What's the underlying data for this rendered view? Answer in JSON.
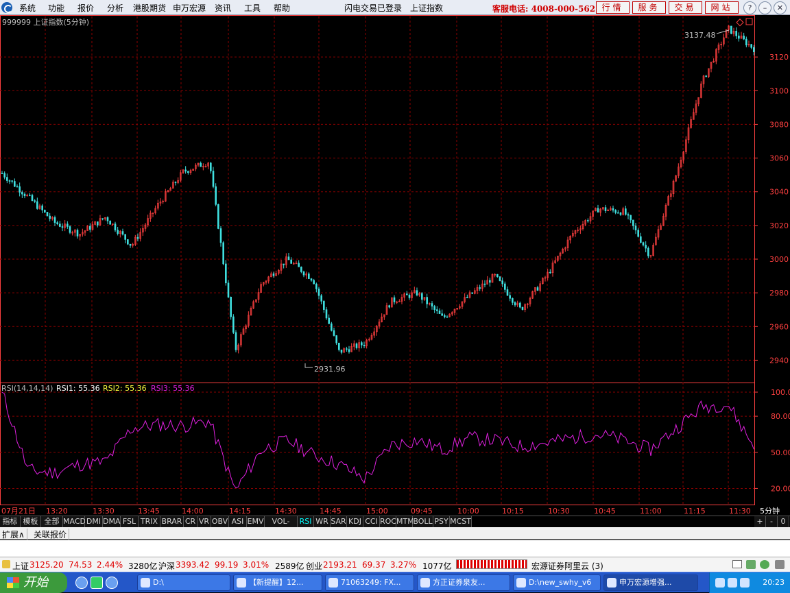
{
  "menubar": {
    "items": [
      "系统",
      "功能",
      "报价",
      "分析",
      "港股期货",
      "申万宏源",
      "资讯",
      "工具",
      "帮助"
    ],
    "login_status": "闪电交易已登录",
    "index_name": "上证指数",
    "service_phone": "客服电话: 4008-000-562",
    "quick_buttons": [
      "行情",
      "服务",
      "交易",
      "网站"
    ]
  },
  "chart": {
    "header": "999999 上证指数(5分钟)",
    "high_label": "3137.48",
    "low_label": "2931.96",
    "price_axis_ticks": [
      3120,
      3100,
      3080,
      3060,
      3040,
      3020,
      3000,
      2980,
      2960,
      2940
    ],
    "rsi_header": {
      "name": "RSI(14,14,14)",
      "rsi1": "RSI1: 55.36",
      "rsi2": "RSI2: 55.36",
      "rsi3": "RSI3: 55.36"
    },
    "rsi_axis_ticks": [
      "100.00",
      "80.00",
      "50.00",
      "20.00"
    ],
    "time_axis": [
      "07月21日",
      "13:20",
      "13:30",
      "13:45",
      "14:00",
      "14:15",
      "14:30",
      "14:45",
      "15:00",
      "09:45",
      "10:00",
      "10:15",
      "10:30",
      "10:45",
      "11:00",
      "11:15",
      "11:30"
    ],
    "period": "5分钟",
    "colors": {
      "up": "#ff4040",
      "down": "#40e0e0",
      "rsi": "#e020e0",
      "grid": "#8b0000",
      "axis": "#ff4040"
    }
  },
  "chart_data": {
    "type": "line",
    "title": "999999 上证指数(5分钟)",
    "xlabel": "",
    "ylabel": "",
    "ylim": [
      2930,
      3140
    ],
    "x": [
      "07月21日",
      "13:20",
      "13:30",
      "13:45",
      "14:00",
      "14:15",
      "14:30",
      "14:45",
      "15:00",
      "09:45",
      "10:00",
      "10:15",
      "10:30",
      "10:45",
      "11:00",
      "11:15",
      "11:30"
    ],
    "series": [
      {
        "values": [
          3051,
          3037,
          3022,
          3015,
          3025,
          3008,
          3032,
          3052,
          3058,
          2946,
          2985,
          3000,
          2988,
          2945,
          2950,
          2975,
          2980,
          2965,
          2978,
          2990,
          2970,
          2990,
          3015,
          3030,
          3028,
          3002,
          3050,
          3105,
          3137,
          3125
        ]
      }
    ],
    "annotations": {
      "high": 3137.48,
      "low": 2931.96
    },
    "rsi": {
      "name": "RSI(14,14,14)",
      "ylim": [
        10,
        100
      ],
      "values": [
        100,
        35,
        33,
        40,
        42,
        70,
        73,
        72,
        76,
        18,
        52,
        60,
        48,
        40,
        28,
        56,
        60,
        52,
        62,
        60,
        55,
        58,
        62,
        65,
        60,
        52,
        70,
        88,
        90,
        55
      ]
    }
  },
  "tabs": {
    "items": [
      "指标",
      "模板",
      "全部",
      "MACD",
      "DMI",
      "DMA",
      "FSL",
      "TRIX",
      "BRAR",
      "CR",
      "VR",
      "OBV",
      "ASI",
      "EMV",
      "VOL-TDX",
      "RSI",
      "WR",
      "SAR",
      "KDJ",
      "CCI",
      "ROC",
      "MTM",
      "BOLL",
      "PSY",
      "MCST"
    ],
    "active": "RSI",
    "right_controls": [
      "+",
      "-",
      "0"
    ]
  },
  "ext_bar": {
    "items": [
      "扩展∧",
      "关联报价"
    ]
  },
  "status": {
    "sh_label": "上证",
    "sh_value": "3125.20",
    "sh_change": "74.53",
    "sh_pct": "2.44%",
    "sh_amount": "3280亿",
    "hs_label": "沪深",
    "hs_value": "3393.42",
    "hs_change": "99.19",
    "hs_pct": "3.01%",
    "hs_amount": "2589亿",
    "cy_label": "创业",
    "cy_value": "2193.21",
    "cy_change": "69.37",
    "cy_pct": "3.27%",
    "cy_amount": "1077亿",
    "server": "宏源证券阿里云 (3)"
  },
  "taskbar": {
    "start_label": "开始",
    "tasks": [
      "D:\\",
      "【新提醒】12...",
      "71063249: FX...",
      "方正证券泉友...",
      "D:\\new_swhy_v6",
      "申万宏源增强..."
    ],
    "clock": "20:23"
  }
}
